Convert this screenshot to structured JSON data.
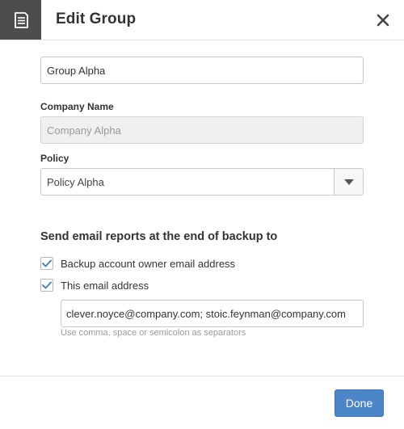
{
  "header": {
    "title": "Edit Group",
    "icon": "document-icon",
    "close_icon": "close-icon"
  },
  "form": {
    "group_name": {
      "value": "Group Alpha"
    },
    "company_name": {
      "label": "Company Name",
      "value": "Company Alpha",
      "disabled": true
    },
    "policy": {
      "label": "Policy",
      "selected": "Policy Alpha"
    },
    "email_reports": {
      "title": "Send email reports at the end of backup to",
      "options": [
        {
          "label": "Backup account owner email address",
          "checked": true
        },
        {
          "label": "This email address",
          "checked": true
        }
      ],
      "email_value": "clever.noyce@company.com; stoic.feynman@company.com",
      "hint": "Use comma, space or semicolon as separators"
    }
  },
  "footer": {
    "done_label": "Done"
  },
  "colors": {
    "header_icon_bg": "#4d4d4d",
    "primary": "#4a86c8",
    "check": "#3a7bbf"
  }
}
